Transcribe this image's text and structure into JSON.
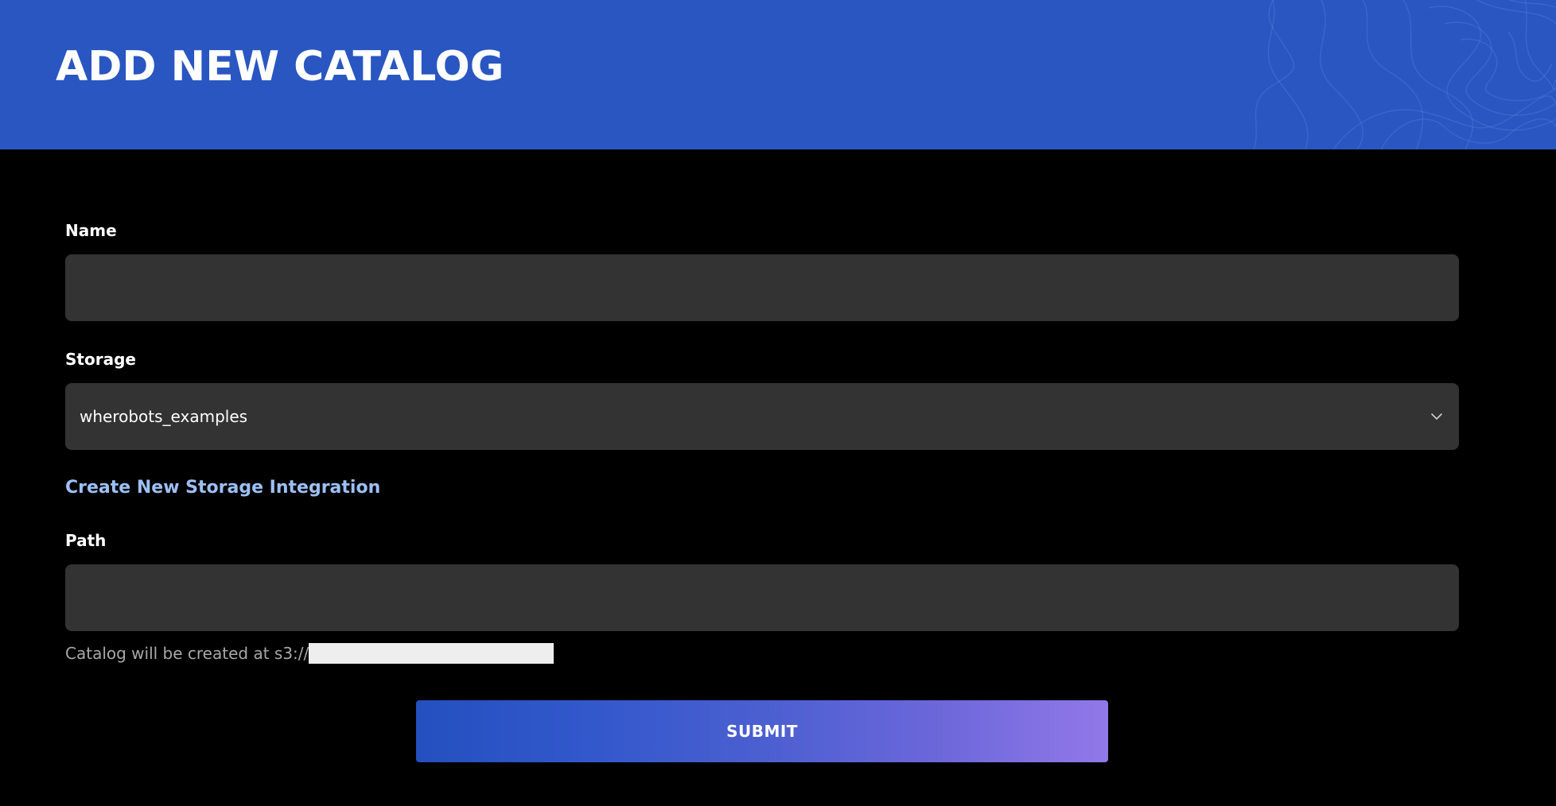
{
  "header": {
    "title": "ADD NEW CATALOG",
    "background_color": "#2956c1"
  },
  "form": {
    "name": {
      "label": "Name",
      "value": "",
      "placeholder": ""
    },
    "storage": {
      "label": "Storage",
      "selected": "wherobots_examples",
      "icon": "chevron-down-icon"
    },
    "create_storage_link": "Create New Storage Integration",
    "path": {
      "label": "Path",
      "value": "",
      "placeholder": ""
    },
    "helper_text": "Catalog will be created at s3://",
    "submit_label": "SUBMIT"
  },
  "colors": {
    "page_background": "#000000",
    "input_background": "#333333",
    "link": "#9cc0f5",
    "submit_gradient_start": "#2450bf",
    "submit_gradient_end": "#9278e8"
  }
}
